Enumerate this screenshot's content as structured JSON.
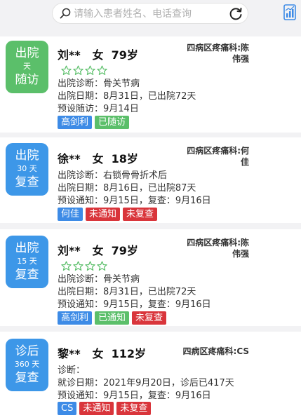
{
  "search": {
    "placeholder": "请输入患者姓名、电话查询",
    "value": ""
  },
  "icons": {
    "search": "search-icon",
    "refresh": "refresh-icon",
    "report": "report-icon",
    "star": "star-outline-icon"
  },
  "colors": {
    "green": "#5bbf6a",
    "blue": "#3d97e8",
    "tag_blue": "#3d8be6",
    "tag_red": "#d9353b"
  },
  "records": [
    {
      "status": {
        "top": "出院",
        "days": "天",
        "bottom": "随访"
      },
      "name": "刘**",
      "gender": "女",
      "age": "79岁",
      "dept": "四病区疼痛科:陈伟强",
      "rating": 0,
      "lines": [
        "出院诊断：骨关节病",
        "出院日期：8月31日，已出院72天",
        "预设随访：9月14日"
      ],
      "tags": [
        "高剑利",
        "已随访"
      ]
    },
    {
      "status": {
        "top": "出院",
        "days": "30 天",
        "bottom": "复查"
      },
      "name": "徐**",
      "gender": "女",
      "age": "18岁",
      "dept": "四病区疼痛科:何佳",
      "lines": [
        "出院诊断：右锁骨骨折术后",
        "出院日期：8月16日，已出院87天",
        "预设通知：9月15日，复查：9月16日"
      ],
      "tags": [
        "何佳",
        "未通知",
        "未复查"
      ]
    },
    {
      "status": {
        "top": "出院",
        "days": "15 天",
        "bottom": "复查"
      },
      "name": "刘**",
      "gender": "女",
      "age": "79岁",
      "dept": "四病区疼痛科:陈伟强",
      "rating": 0,
      "lines": [
        "出院诊断：骨关节病",
        "出院日期：8月31日，已出院72天",
        "预设通知：9月15日，复查：9月16日"
      ],
      "tags": [
        "高剑利",
        "已通知",
        "未复查"
      ]
    },
    {
      "status": {
        "top": "诊后",
        "days": "360 天",
        "bottom": "复查"
      },
      "name": "黎**",
      "gender": "女",
      "age": "112岁",
      "dept": "四病区疼痛科:CS",
      "lines": [
        "诊断：",
        "就诊日期：2021年9月20日，诊后已417天",
        "预设通知：9月15日，复查：9月16日"
      ],
      "tags": [
        "CS",
        "未通知",
        "未复查"
      ]
    }
  ]
}
